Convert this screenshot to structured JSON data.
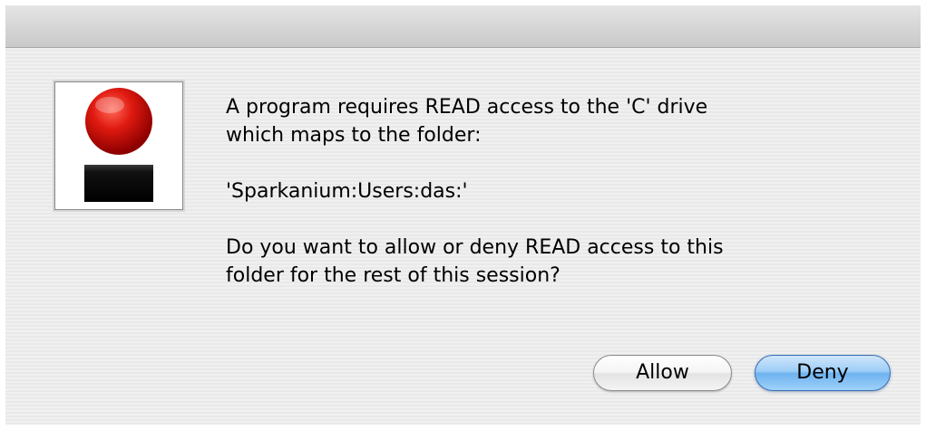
{
  "dialog": {
    "icon": "red-ball-app-icon",
    "message": {
      "line1": "A program requires READ access to the 'C' drive",
      "line2": "which maps to the folder:",
      "folder": "'Sparkanium:Users:das:'",
      "line3": "Do you want to allow or deny READ access to this",
      "line4": "folder for the rest of this session?"
    },
    "buttons": {
      "allow_label": "Allow",
      "deny_label": "Deny"
    },
    "colors": {
      "icon_ball": "#d40000",
      "default_button": "#6fb2ef"
    }
  }
}
